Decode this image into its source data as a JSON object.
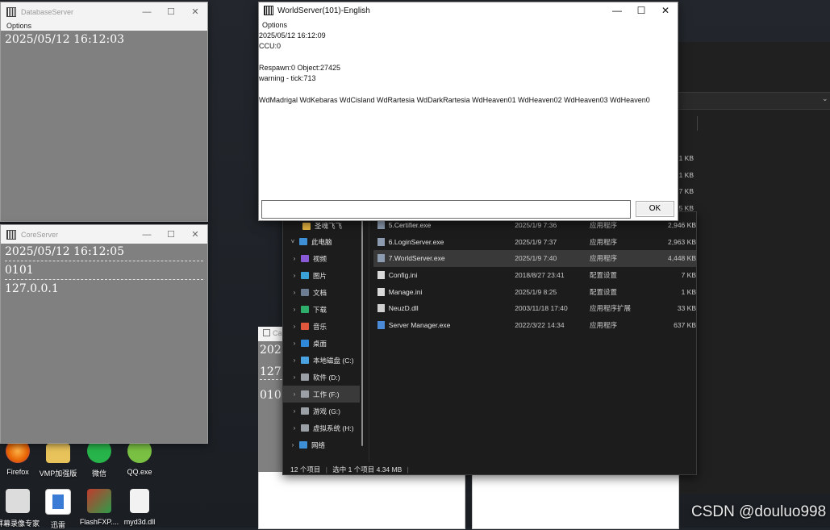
{
  "desktop": {
    "icons_row1": [
      {
        "label": "Firefox",
        "icon": "firefox-icon",
        "color": "#e66000"
      },
      {
        "label": "VMP加强版",
        "icon": "folder-icon",
        "color": "#e8c25a"
      },
      {
        "label": "微信",
        "icon": "wechat-icon",
        "color": "#27b44a"
      },
      {
        "label": "QQ.exe",
        "icon": "qq-icon",
        "color": "#7ac143"
      }
    ],
    "icons_row2": [
      {
        "label": "屏幕录像专家",
        "icon": "recorder-icon",
        "color": "#dcdcdc"
      },
      {
        "label": "迅雷",
        "icon": "thunder-icon",
        "color": "#3a7bd5"
      },
      {
        "label": "FlashFXP....",
        "icon": "flashfxp-icon",
        "color": "#c23b2e"
      },
      {
        "label": "myd3d.dll",
        "icon": "dll-file-icon",
        "color": "#f2f2f2"
      }
    ]
  },
  "database_window": {
    "title": "DatabaseServer",
    "menu": "Options",
    "lines": [
      "2025/05/12  16:12:03"
    ]
  },
  "core_window": {
    "title": "CoreServer",
    "menu": "Options",
    "lines": [
      "2025/05/12  16:12:05",
      "0101",
      "127.0.0.1"
    ]
  },
  "cache_window": {
    "title": "Ca",
    "lines": [
      "2025",
      "127.",
      "0101"
    ]
  },
  "world_window": {
    "title": "WorldServer(101)-English",
    "menu": "Options",
    "lines": [
      "2025/05/12  16:12:09",
      "CCU:0",
      "",
      "Respawn:0  Object:27425",
      "warning - tick:713",
      "",
      "WdMadrigal WdKebaras WdCisland WdRartesia WdDarkRartesia WdHeaven01 WdHeaven02 WdHeaven03 WdHeaven0"
    ],
    "input_value": "",
    "ok_label": "OK"
  },
  "explorer": {
    "nav": [
      {
        "label": "圣魂飞飞",
        "icon": "folder-icon",
        "color": "#e3b341",
        "indent": 2,
        "chev": ""
      },
      {
        "label": "此电脑",
        "icon": "pc-icon",
        "color": "#3d8fd6",
        "indent": 0,
        "chev": "˅"
      },
      {
        "label": "视频",
        "icon": "video-icon",
        "color": "#8a5ad6",
        "indent": 1,
        "chev": "›"
      },
      {
        "label": "图片",
        "icon": "pictures-icon",
        "color": "#3aa0d8",
        "indent": 1,
        "chev": "›"
      },
      {
        "label": "文档",
        "icon": "documents-icon",
        "color": "#6b7c93",
        "indent": 1,
        "chev": "›"
      },
      {
        "label": "下载",
        "icon": "downloads-icon",
        "color": "#2fae6b",
        "indent": 1,
        "chev": "›"
      },
      {
        "label": "音乐",
        "icon": "music-icon",
        "color": "#e0573c",
        "indent": 1,
        "chev": "›"
      },
      {
        "label": "桌面",
        "icon": "desktop-icon",
        "color": "#2f89d8",
        "indent": 1,
        "chev": "›"
      },
      {
        "label": "本地磁盘 (C:)",
        "icon": "drive-c-icon",
        "color": "#4aa3e0",
        "indent": 1,
        "chev": "›"
      },
      {
        "label": "软件 (D:)",
        "icon": "drive-icon",
        "color": "#9aa0a6",
        "indent": 1,
        "chev": "›"
      },
      {
        "label": "工作 (F:)",
        "icon": "drive-icon",
        "color": "#9aa0a6",
        "indent": 1,
        "chev": "›"
      },
      {
        "label": "游戏 (G:)",
        "icon": "drive-icon",
        "color": "#9aa0a6",
        "indent": 1,
        "chev": "›"
      },
      {
        "label": "虚拟系统 (H:)",
        "icon": "drive-icon",
        "color": "#9aa0a6",
        "indent": 1,
        "chev": "›"
      },
      {
        "label": "网络",
        "icon": "network-icon",
        "color": "#3d8fd6",
        "indent": 0,
        "chev": "›"
      }
    ],
    "selected_nav": "工作 (F:)",
    "hidden_sizes": [
      "1 KB",
      "1 KB",
      "7 KB",
      "5 KB"
    ],
    "files": [
      {
        "name": "5.Certifier.exe",
        "date": "2025/1/9 7:36",
        "type": "应用程序",
        "size": "2,946 KB",
        "icon": "exe-icon"
      },
      {
        "name": "6.LoginServer.exe",
        "date": "2025/1/9 7:37",
        "type": "应用程序",
        "size": "2,963 KB",
        "icon": "exe-icon"
      },
      {
        "name": "7.WorldServer.exe",
        "date": "2025/1/9 7:40",
        "type": "应用程序",
        "size": "4,448 KB",
        "icon": "exe-icon"
      },
      {
        "name": "Config.ini",
        "date": "2018/8/27 23:41",
        "type": "配置设置",
        "size": "7 KB",
        "icon": "ini-icon"
      },
      {
        "name": "Manage.ini",
        "date": "2025/1/9 8:25",
        "type": "配置设置",
        "size": "1 KB",
        "icon": "ini-icon"
      },
      {
        "name": "NeuzD.dll",
        "date": "2003/11/18 17:40",
        "type": "应用程序扩展",
        "size": "33 KB",
        "icon": "dll-icon"
      },
      {
        "name": "Server Manager.exe",
        "date": "2022/3/22 14:34",
        "type": "应用程序",
        "size": "637 KB",
        "icon": "server-manager-icon"
      }
    ],
    "selected_file": "7.WorldServer.exe",
    "status": {
      "count": "12 个项目",
      "selection": "选中 1 个项目  4.34 MB"
    }
  },
  "watermark": "CSDN @douluo998",
  "colors": {
    "classic_body": "#808080",
    "explorer_bg": "#1c1c1c",
    "selection": "#393939"
  }
}
